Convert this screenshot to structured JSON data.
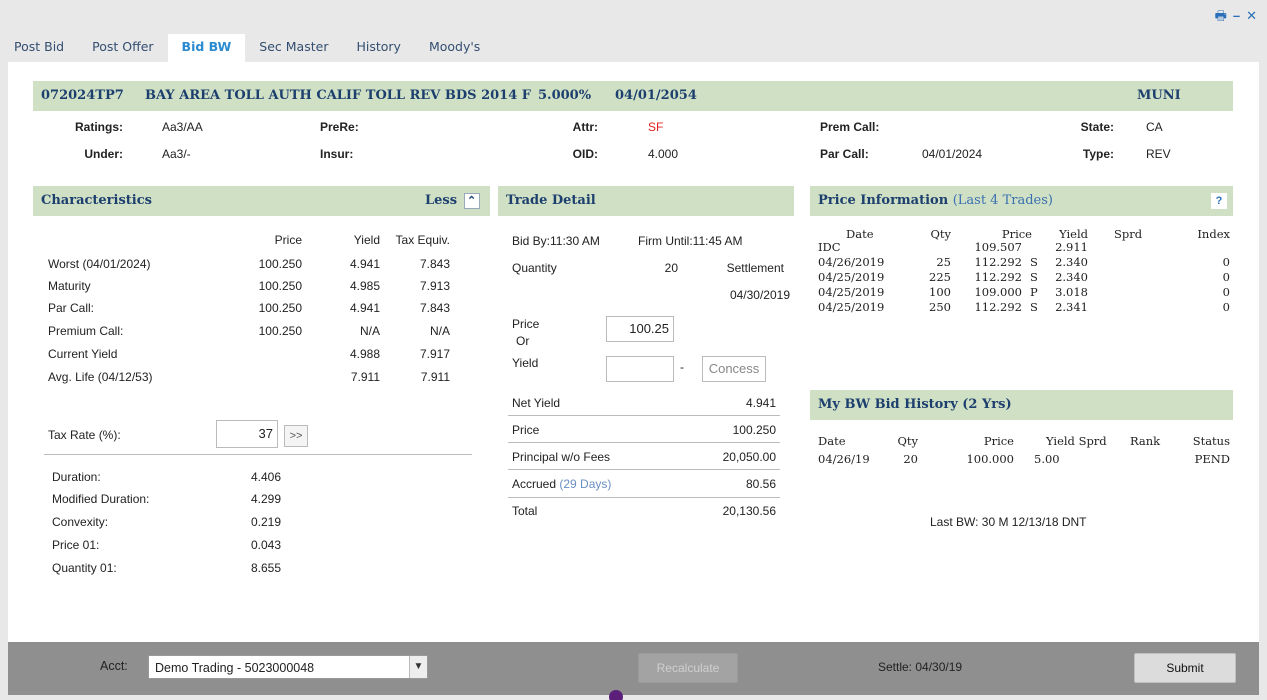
{
  "window": {
    "controls": [
      "print-icon",
      "minimize-icon",
      "close-icon"
    ]
  },
  "tabs": [
    {
      "label": "Post Bid",
      "active": false
    },
    {
      "label": "Post Offer",
      "active": false
    },
    {
      "label": "Bid BW",
      "active": true
    },
    {
      "label": "Sec Master",
      "active": false
    },
    {
      "label": "History",
      "active": false
    },
    {
      "label": "Moody's",
      "active": false
    }
  ],
  "security": {
    "cusip": "072024TP7",
    "description": "BAY AREA TOLL AUTH CALIF TOLL REV BDS 2014 F",
    "coupon": "5.000%",
    "maturity": "04/01/2054",
    "type": "MUNI"
  },
  "summary": {
    "ratings_label": "Ratings:",
    "ratings": "Aa3/AA",
    "under_label": "Under:",
    "under": "Aa3/-",
    "prere_label": "PreRe:",
    "insur_label": "Insur:",
    "attr_label": "Attr:",
    "attr": "SF",
    "oid_label": "OID:",
    "oid": "4.000",
    "premcall_label": "Prem Call:",
    "premcall": "",
    "parcall_label": "Par Call:",
    "parcall": "04/01/2024",
    "state_label": "State:",
    "state": "CA",
    "type_label": "Type:",
    "type": "REV"
  },
  "characteristics": {
    "title": "Characteristics",
    "toggle": "Less",
    "headers": [
      "Price",
      "Yield",
      "Tax Equiv."
    ],
    "rows": [
      {
        "label": "Worst (04/01/2024)",
        "price": "100.250",
        "yield": "4.941",
        "tax": "7.843"
      },
      {
        "label": "Maturity",
        "price": "100.250",
        "yield": "4.985",
        "tax": "7.913"
      },
      {
        "label": "Par Call:",
        "price": "100.250",
        "yield": "4.941",
        "tax": "7.843"
      },
      {
        "label": "Premium Call:",
        "price": "100.250",
        "yield": "N/A",
        "tax": "N/A"
      },
      {
        "label": "Current Yield",
        "price": "",
        "yield": "4.988",
        "tax": "7.917"
      },
      {
        "label": "Avg. Life (04/12/53)",
        "price": "",
        "yield": "7.911",
        "tax": "7.911"
      }
    ],
    "tax_rate_label": "Tax Rate (%):",
    "tax_rate": "37",
    "tax_rate_btn": ">>",
    "metrics": [
      {
        "label": "Duration:",
        "value": "4.406"
      },
      {
        "label": "Modified Duration:",
        "value": "4.299"
      },
      {
        "label": "Convexity:",
        "value": "0.219"
      },
      {
        "label": "Price 01:",
        "value": "0.043"
      },
      {
        "label": "Quantity 01:",
        "value": "8.655"
      }
    ]
  },
  "trade": {
    "title": "Trade Detail",
    "bid_by": "Bid By:11:30 AM",
    "firm_until": "Firm Until:11:45 AM",
    "quantity_label": "Quantity",
    "quantity": "20",
    "settlement_label": "Settlement",
    "settlement": "04/30/2019",
    "price_label": "Price",
    "or_label": "Or",
    "yield_label": "Yield",
    "price_value": "100.25",
    "yield_value": "",
    "dash": "-",
    "concess_placeholder": "Concess",
    "summary": [
      {
        "label": "Net Yield",
        "value": "4.941"
      },
      {
        "label": "Price",
        "value": "100.250"
      },
      {
        "label": "Principal w/o Fees",
        "value": "20,050.00"
      },
      {
        "label": "Accrued",
        "days": "(29 Days)",
        "value": "80.56"
      },
      {
        "label": "Total",
        "value": "20,130.56"
      }
    ]
  },
  "price_info": {
    "title": "Price Information",
    "subtitle": "(Last 4 Trades)",
    "help": "?",
    "headers": [
      "Date",
      "Qty",
      "Price",
      "Yield",
      "Sprd",
      "Index"
    ],
    "rows": [
      {
        "date": "IDC",
        "qty": "",
        "price": "109.507",
        "flag": "",
        "yield": "2.911",
        "sprd": "",
        "index": ""
      },
      {
        "date": "04/26/2019",
        "qty": "25",
        "price": "112.292",
        "flag": "S",
        "yield": "2.340",
        "sprd": "",
        "index": "0"
      },
      {
        "date": "04/25/2019",
        "qty": "225",
        "price": "112.292",
        "flag": "S",
        "yield": "2.340",
        "sprd": "",
        "index": "0"
      },
      {
        "date": "04/25/2019",
        "qty": "100",
        "price": "109.000",
        "flag": "P",
        "yield": "3.018",
        "sprd": "",
        "index": "0"
      },
      {
        "date": "04/25/2019",
        "qty": "250",
        "price": "112.292",
        "flag": "S",
        "yield": "2.341",
        "sprd": "",
        "index": "0"
      }
    ]
  },
  "bid_history": {
    "title": "My BW Bid History (2 Yrs)",
    "headers": [
      "Date",
      "Qty",
      "Price",
      "Yield Sprd",
      "Rank",
      "Status"
    ],
    "rows": [
      {
        "date": "04/26/19",
        "qty": "20",
        "price": "100.000",
        "yield": "5.00",
        "rank": "",
        "status": "PEND"
      }
    ],
    "last_bw": "Last BW: 30 M 12/13/18 DNT"
  },
  "footer": {
    "acct_label": "Acct:",
    "acct_value": "Demo Trading - 5023000048",
    "recalc": "Recalculate",
    "settle": "Settle: 04/30/19",
    "submit": "Submit"
  }
}
